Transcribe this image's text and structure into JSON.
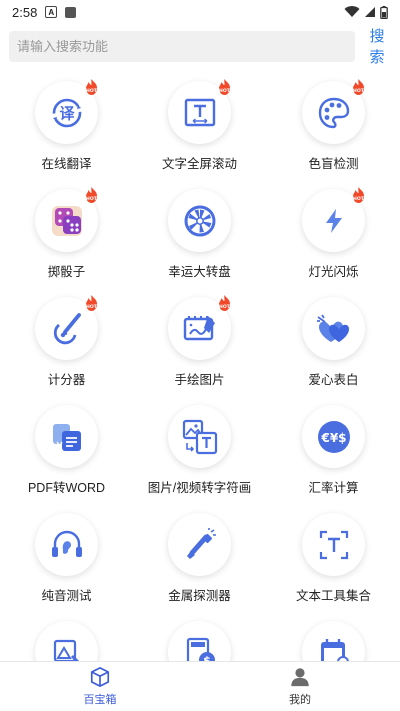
{
  "status_bar": {
    "time": "2:58",
    "notification_letter": "A"
  },
  "search": {
    "placeholder": "请输入搜索功能",
    "button_label": "搜索"
  },
  "tools": [
    {
      "label": "在线翻译",
      "icon": "translate-icon",
      "hot": true
    },
    {
      "label": "文字全屏滚动",
      "icon": "text-scroll-icon",
      "hot": true
    },
    {
      "label": "色盲检测",
      "icon": "palette-icon",
      "hot": true
    },
    {
      "label": "掷骰子",
      "icon": "dice-icon",
      "hot": true
    },
    {
      "label": "幸运大转盘",
      "icon": "wheel-icon",
      "hot": false
    },
    {
      "label": "灯光闪烁",
      "icon": "flash-icon",
      "hot": true
    },
    {
      "label": "计分器",
      "icon": "score-icon",
      "hot": true
    },
    {
      "label": "手绘图片",
      "icon": "draw-icon",
      "hot": true
    },
    {
      "label": "爱心表白",
      "icon": "heart-icon",
      "hot": false
    },
    {
      "label": "PDF转WORD",
      "icon": "pdf-word-icon",
      "hot": false
    },
    {
      "label": "图片/视频转字符画",
      "icon": "image-to-text-icon",
      "hot": false
    },
    {
      "label": "汇率计算",
      "icon": "exchange-icon",
      "hot": false
    },
    {
      "label": "纯音测试",
      "icon": "hearing-icon",
      "hot": false
    },
    {
      "label": "金属探测器",
      "icon": "metal-detector-icon",
      "hot": false
    },
    {
      "label": "文本工具集合",
      "icon": "text-tool-icon",
      "hot": false
    },
    {
      "label": "",
      "icon": "photo-edit-icon",
      "hot": false
    },
    {
      "label": "",
      "icon": "calculator-icon",
      "hot": false
    },
    {
      "label": "",
      "icon": "calendar-icon",
      "hot": false
    }
  ],
  "nav": {
    "items": [
      {
        "label": "百宝箱",
        "icon": "box-icon",
        "active": true
      },
      {
        "label": "我的",
        "icon": "user-icon",
        "active": false
      }
    ]
  },
  "colors": {
    "accent": "#3b5bdb",
    "search_link": "#2b7de9",
    "hot_badge": "#f04a2a"
  }
}
